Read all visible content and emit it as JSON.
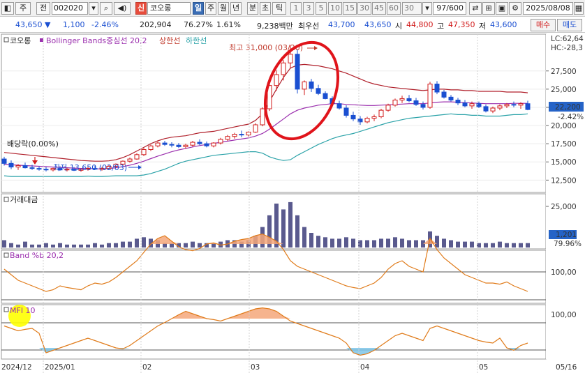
{
  "toolbar": {
    "market_label": "주",
    "prev_label": "전",
    "stock_code": "002020",
    "search_icon": "search-icon",
    "sound_icon": "speaker-icon",
    "new_badge": "신",
    "stock_name": "코오롱",
    "periods": [
      "일",
      "주",
      "월",
      "년",
      "분",
      "초",
      "틱"
    ],
    "active_period": "일",
    "intervals": [
      "1",
      "3",
      "5",
      "10",
      "15",
      "30",
      "45",
      "60"
    ],
    "custom_interval": "30",
    "count_display": "97/600",
    "date": "2025/08/08"
  },
  "quote": {
    "price": "43,650",
    "change": "1,100",
    "change_pct": "-2.46%",
    "volume": "202,904",
    "volume_ratio": "76.27%",
    "turnover": "1.61%",
    "amount": "9,238백만",
    "best_ask_label": "최우선",
    "best_ask": "43,700",
    "best_bid": "43,650",
    "open_label": "시",
    "open": "44,800",
    "high_label": "고",
    "high": "47,350",
    "low_label": "저",
    "low": "43,600",
    "buy_label": "매수",
    "sell_label": "매도"
  },
  "chart_data": [
    {
      "type": "candlestick",
      "panel": "price",
      "legend": [
        "코오롱",
        "Bollinger Bands중심선 20,2",
        "상한선",
        "하한선"
      ],
      "annotations": {
        "high": "최고 31,000 (03/20)",
        "low": "최저 13,650 (02/03)",
        "dividend": "배당락(0.00%)",
        "lc": "LC:62,64",
        "hc": "HC:-28,3",
        "current_price": "22,200",
        "current_change": "-2.42%"
      },
      "y_ticks": [
        "27,500",
        "25,000",
        "22,500",
        "20,000",
        "17,500",
        "15,000",
        "12,500"
      ],
      "ylim": [
        11000,
        31500
      ],
      "candles": [
        [
          15400,
          15700,
          14500,
          14800
        ],
        [
          14800,
          15200,
          14000,
          14300
        ],
        [
          14300,
          14700,
          13900,
          14500
        ],
        [
          14500,
          14900,
          14100,
          14200
        ],
        [
          14200,
          14600,
          13900,
          14100
        ],
        [
          14100,
          14400,
          13800,
          14000
        ],
        [
          14000,
          14300,
          13700,
          13900
        ],
        [
          13900,
          14200,
          13700,
          14100
        ],
        [
          14100,
          14400,
          13800,
          13900
        ],
        [
          13900,
          14200,
          13700,
          14000
        ],
        [
          14000,
          14300,
          13750,
          13850
        ],
        [
          13850,
          14100,
          13650,
          14000
        ],
        [
          14000,
          14300,
          13800,
          14100
        ],
        [
          14100,
          14500,
          13900,
          14000
        ],
        [
          14000,
          14300,
          13800,
          14100
        ],
        [
          14100,
          14600,
          14000,
          14400
        ],
        [
          14400,
          14800,
          14200,
          14700
        ],
        [
          14700,
          15200,
          14500,
          15100
        ],
        [
          15100,
          15600,
          14900,
          15400
        ],
        [
          15400,
          16200,
          15300,
          16000
        ],
        [
          16000,
          16900,
          15800,
          16700
        ],
        [
          16700,
          17400,
          16500,
          17200
        ],
        [
          17200,
          17800,
          17000,
          17600
        ],
        [
          17600,
          17900,
          17200,
          17400
        ],
        [
          17400,
          17700,
          17000,
          17300
        ],
        [
          17300,
          17600,
          16900,
          17100
        ],
        [
          17100,
          17500,
          16800,
          17300
        ],
        [
          17300,
          17900,
          17100,
          17700
        ],
        [
          17700,
          18100,
          17300,
          17500
        ],
        [
          17500,
          17800,
          17000,
          17200
        ],
        [
          17200,
          17700,
          17000,
          17600
        ],
        [
          17600,
          18300,
          17400,
          18100
        ],
        [
          18100,
          18700,
          17900,
          18500
        ],
        [
          18500,
          19000,
          18200,
          18800
        ],
        [
          18800,
          19300,
          18400,
          18700
        ],
        [
          18700,
          19200,
          18500,
          19100
        ],
        [
          19100,
          20300,
          19000,
          20100
        ],
        [
          20100,
          22500,
          19900,
          22300
        ],
        [
          22300,
          25800,
          22000,
          25500
        ],
        [
          25500,
          27600,
          24800,
          27000
        ],
        [
          27000,
          29000,
          26200,
          28600
        ],
        [
          28600,
          31000,
          27800,
          29800
        ],
        [
          29800,
          30500,
          24400,
          25000
        ],
        [
          25000,
          26200,
          24200,
          26000
        ],
        [
          26000,
          26400,
          24600,
          25100
        ],
        [
          25100,
          25600,
          24200,
          24400
        ],
        [
          24400,
          24700,
          23600,
          23700
        ],
        [
          23700,
          24000,
          22900,
          23000
        ],
        [
          23000,
          23400,
          22200,
          22400
        ],
        [
          22400,
          22800,
          21100,
          21400
        ],
        [
          21400,
          21900,
          20600,
          20900
        ],
        [
          20900,
          21300,
          20100,
          20500
        ],
        [
          20500,
          21200,
          20300,
          21000
        ],
        [
          21000,
          21500,
          20600,
          21200
        ],
        [
          21200,
          22300,
          21000,
          22100
        ],
        [
          22100,
          23000,
          21900,
          22800
        ],
        [
          22800,
          23700,
          22600,
          23500
        ],
        [
          23500,
          24100,
          23100,
          23700
        ],
        [
          23700,
          24200,
          23200,
          23400
        ],
        [
          23400,
          23800,
          22700,
          22900
        ],
        [
          22900,
          23300,
          22200,
          22500
        ],
        [
          22500,
          26000,
          22300,
          25700
        ],
        [
          25700,
          26100,
          24300,
          24600
        ],
        [
          24600,
          24900,
          23700,
          23900
        ],
        [
          23900,
          24200,
          23300,
          23500
        ],
        [
          23500,
          23800,
          22800,
          23100
        ],
        [
          23100,
          23500,
          22500,
          22700
        ],
        [
          22700,
          23300,
          22300,
          23000
        ],
        [
          23000,
          23300,
          22400,
          22600
        ],
        [
          22600,
          22900,
          21800,
          22000
        ],
        [
          22000,
          22600,
          21700,
          22400
        ],
        [
          22400,
          22900,
          22100,
          22700
        ],
        [
          22700,
          23100,
          22400,
          22900
        ],
        [
          22900,
          23300,
          22500,
          22800
        ],
        [
          22800,
          23200,
          22300,
          23000
        ],
        [
          23000,
          23400,
          22100,
          22200
        ]
      ],
      "bollinger_upper": [
        16300,
        16200,
        16100,
        16000,
        15900,
        15800,
        15700,
        15600,
        15500,
        15400,
        15300,
        15200,
        15150,
        15100,
        15100,
        15150,
        15300,
        15600,
        16000,
        16500,
        17000,
        17500,
        17900,
        18200,
        18400,
        18500,
        18600,
        18800,
        19000,
        19100,
        19200,
        19400,
        19600,
        19800,
        20000,
        20200,
        20700,
        21600,
        23300,
        25000,
        26600,
        27900,
        28300,
        28400,
        28300,
        28200,
        28000,
        27800,
        27500,
        27200,
        26800,
        26400,
        26000,
        25700,
        25500,
        25300,
        25200,
        25100,
        25000,
        24900,
        24800,
        24900,
        25000,
        25000,
        24900,
        24900,
        24800,
        24800,
        24700,
        24700,
        24700,
        24700,
        24600,
        24600,
        24600,
        24500
      ],
      "bollinger_mid": [
        14700,
        14600,
        14550,
        14500,
        14450,
        14400,
        14350,
        14300,
        14250,
        14200,
        14150,
        14100,
        14100,
        14050,
        14050,
        14100,
        14200,
        14350,
        14550,
        14800,
        15100,
        15450,
        15800,
        16100,
        16400,
        16650,
        16850,
        17050,
        17250,
        17400,
        17550,
        17700,
        17850,
        18000,
        18150,
        18300,
        18550,
        18900,
        19500,
        20200,
        20900,
        21600,
        22100,
        22400,
        22600,
        22800,
        22900,
        23000,
        23000,
        22900,
        22850,
        22800,
        22750,
        22750,
        22800,
        22850,
        22900,
        22950,
        23000,
        23000,
        23000,
        23100,
        23200,
        23250,
        23250,
        23200,
        23150,
        23100,
        23050,
        23000,
        23000,
        23000,
        23000,
        23050,
        23050,
        23050
      ],
      "bollinger_lower": [
        13100,
        13000,
        13000,
        13000,
        13000,
        13000,
        13000,
        13000,
        13000,
        13000,
        13000,
        13000,
        13050,
        13000,
        13000,
        13050,
        13100,
        13100,
        13100,
        13100,
        13200,
        13400,
        13700,
        14000,
        14400,
        14800,
        15100,
        15300,
        15500,
        15700,
        15900,
        16000,
        16100,
        16200,
        16300,
        16400,
        16400,
        16200,
        15700,
        15400,
        15200,
        15300,
        15900,
        16400,
        16900,
        17400,
        17800,
        18200,
        18500,
        18700,
        18900,
        19200,
        19500,
        19800,
        20100,
        20400,
        20600,
        20800,
        21000,
        21100,
        21200,
        21300,
        21400,
        21500,
        21600,
        21500,
        21500,
        21400,
        21400,
        21300,
        21300,
        21300,
        21400,
        21500,
        21500,
        21600
      ]
    },
    {
      "type": "bar",
      "panel": "trading_value",
      "legend": [
        "거래대금"
      ],
      "y_ticks": [
        "25,000"
      ],
      "current_value": "1,201",
      "current_pct": "79.96%",
      "values": [
        5,
        3,
        2,
        4,
        2,
        2,
        3,
        2,
        3,
        2,
        2,
        2,
        2,
        3,
        2,
        3,
        3,
        4,
        4,
        6,
        7,
        6,
        5,
        3,
        3,
        3,
        3,
        4,
        3,
        3,
        3,
        4,
        5,
        5,
        4,
        5,
        8,
        14,
        22,
        30,
        26,
        31,
        22,
        14,
        10,
        8,
        7,
        6,
        6,
        7,
        6,
        5,
        5,
        5,
        6,
        6,
        7,
        6,
        5,
        5,
        5,
        11,
        8,
        6,
        5,
        4,
        4,
        4,
        3,
        3,
        3,
        4,
        3,
        3,
        3,
        3
      ]
    },
    {
      "type": "line",
      "panel": "band_pct_b",
      "legend": [
        "Band %b 20,2"
      ],
      "y_ticks": [
        "100,00"
      ],
      "values": [
        55,
        45,
        35,
        30,
        25,
        20,
        15,
        18,
        25,
        22,
        20,
        18,
        25,
        30,
        28,
        32,
        40,
        50,
        60,
        70,
        85,
        100,
        110,
        115,
        105,
        95,
        90,
        88,
        92,
        100,
        102,
        98,
        100,
        105,
        108,
        110,
        115,
        118,
        112,
        105,
        90,
        70,
        60,
        55,
        50,
        45,
        40,
        35,
        30,
        25,
        22,
        20,
        25,
        30,
        40,
        55,
        65,
        70,
        60,
        55,
        50,
        110,
        90,
        75,
        65,
        55,
        45,
        40,
        35,
        30,
        30,
        28,
        32,
        25,
        20,
        15
      ]
    },
    {
      "type": "line",
      "panel": "mfi",
      "legend": [
        "MFI 10"
      ],
      "y_ticks": [
        "100,00"
      ],
      "values": [
        65,
        60,
        55,
        58,
        60,
        50,
        10,
        15,
        20,
        25,
        30,
        35,
        40,
        35,
        30,
        25,
        20,
        18,
        25,
        35,
        45,
        55,
        65,
        72,
        80,
        88,
        95,
        90,
        85,
        80,
        78,
        75,
        80,
        85,
        90,
        95,
        100,
        102,
        100,
        95,
        85,
        75,
        70,
        65,
        60,
        55,
        50,
        45,
        40,
        30,
        10,
        5,
        8,
        15,
        25,
        35,
        45,
        50,
        45,
        40,
        35,
        60,
        65,
        60,
        55,
        50,
        45,
        40,
        35,
        32,
        30,
        40,
        20,
        15,
        25,
        30
      ]
    },
    {
      "type": "axis",
      "panel": "x_axis",
      "labels": [
        "2024/12",
        "2025/01",
        "02",
        "03",
        "04",
        "05",
        "05/16"
      ]
    }
  ]
}
